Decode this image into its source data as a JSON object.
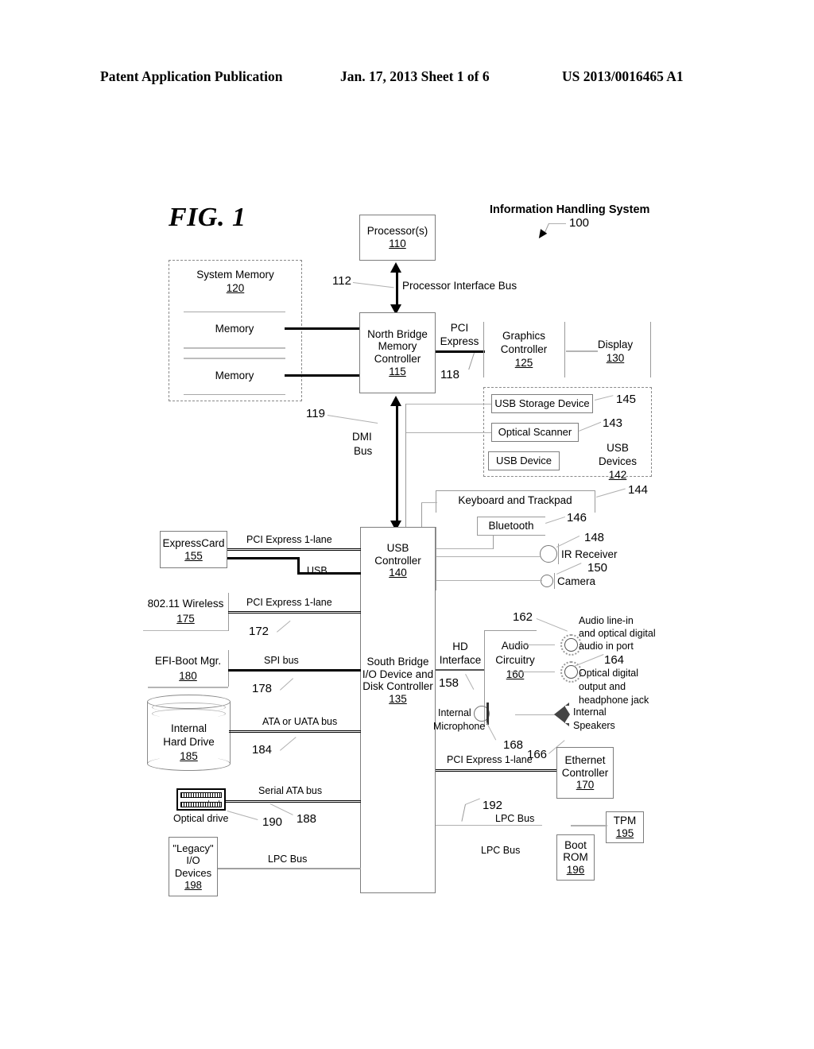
{
  "header": {
    "left": "Patent Application Publication",
    "middle": "Jan. 17, 2013  Sheet 1 of 6",
    "right": "US 2013/0016465 A1"
  },
  "figure": {
    "title": "FIG. 1",
    "system_label": "Information Handling System",
    "system_ref": "100"
  },
  "blocks": {
    "processor": {
      "line1": "Processor(s)",
      "ref": "110"
    },
    "system_memory": {
      "line1": "System Memory",
      "ref": "120",
      "slot1": "Memory",
      "slot2": "Memory"
    },
    "north_bridge": {
      "line1": "North Bridge",
      "line2": "Memory",
      "line3": "Controller",
      "ref": "115"
    },
    "graphics": {
      "line1": "Graphics",
      "line2": "Controller",
      "ref": "125"
    },
    "display": {
      "line1": "Display",
      "ref": "130"
    },
    "usb_storage": {
      "line1": "USB Storage Device"
    },
    "optical_scanner": {
      "line1": "Optical Scanner"
    },
    "usb_device": {
      "line1": "USB Device"
    },
    "usb_devices_grp": {
      "line1": "USB",
      "line2": "Devices",
      "ref": "142"
    },
    "keyboard": {
      "line1": "Keyboard and Trackpad"
    },
    "bluetooth": {
      "line1": "Bluetooth"
    },
    "ir_receiver": {
      "line1": "IR Receiver"
    },
    "camera": {
      "line1": "Camera"
    },
    "usb_controller": {
      "line1": "USB",
      "line2": "Controller",
      "ref": "140"
    },
    "south_bridge": {
      "line1": "South Bridge",
      "line2": "I/O Device and",
      "line3": "Disk Controller",
      "ref": "135"
    },
    "expresscard": {
      "line1": "ExpressCard",
      "ref": "155"
    },
    "wireless": {
      "line1": "802.11 Wireless",
      "ref": "175"
    },
    "efi_boot": {
      "line1": "EFI-Boot Mgr.",
      "ref": "180"
    },
    "hard_drive": {
      "line1": "Internal",
      "line2": "Hard Drive",
      "ref": "185"
    },
    "optical_drive": {
      "line1": "Optical drive"
    },
    "legacy_io": {
      "line1": "\"Legacy\"",
      "line2": "I/O",
      "line3": "Devices",
      "ref": "198"
    },
    "audio": {
      "line1": "Audio",
      "line2": "Circuitry",
      "ref": "160"
    },
    "audio_in": {
      "line1": "Audio line-in",
      "line2": "and optical digital",
      "line3": "audio in port"
    },
    "audio_out": {
      "line1": "Optical digital",
      "line2": "output and",
      "line3": "headphone jack"
    },
    "internal_mic": {
      "line1": "Internal",
      "line2": "Microphone"
    },
    "internal_spk": {
      "line1": "Internal",
      "line2": "Speakers"
    },
    "ethernet": {
      "line1": "Ethernet",
      "line2": "Controller",
      "ref": "170"
    },
    "tpm": {
      "line1": "TPM",
      "ref": "195"
    },
    "boot_rom": {
      "line1": "Boot",
      "line2": "ROM",
      "ref": "196"
    }
  },
  "bus_labels": {
    "processor_interface": "Processor Interface Bus",
    "pci_express_nb": "PCI\nExpress",
    "pci_express_l1": "PCI",
    "pci_express_l2": "Express",
    "dmi_1": "DMI",
    "dmi_2": "Bus",
    "pcie_1lane_expresscard": "PCI Express 1-lane",
    "usb": "USB",
    "pcie_1lane_wireless": "PCI Express 1-lane",
    "spi_bus": "SPI bus",
    "ata_bus": "ATA or UATA bus",
    "serial_ata_bus": "Serial ATA bus",
    "lpc_bus_left": "LPC Bus",
    "hd_interface_1": "HD",
    "hd_interface_2": "Interface",
    "pcie_1lane_ethernet": "PCI Express 1-lane",
    "lpc_bus_right_1": "LPC Bus",
    "lpc_bus_right_2": "LPC Bus"
  },
  "ref_numbers": {
    "n100": "100",
    "n112": "112",
    "n118": "118",
    "n119": "119",
    "n143": "143",
    "n144": "144",
    "n145": "145",
    "n146": "146",
    "n148": "148",
    "n150": "150",
    "n158": "158",
    "n162": "162",
    "n164": "164",
    "n166": "166",
    "n168": "168",
    "n172": "172",
    "n178": "178",
    "n184": "184",
    "n188": "188",
    "n190": "190",
    "n192": "192"
  }
}
